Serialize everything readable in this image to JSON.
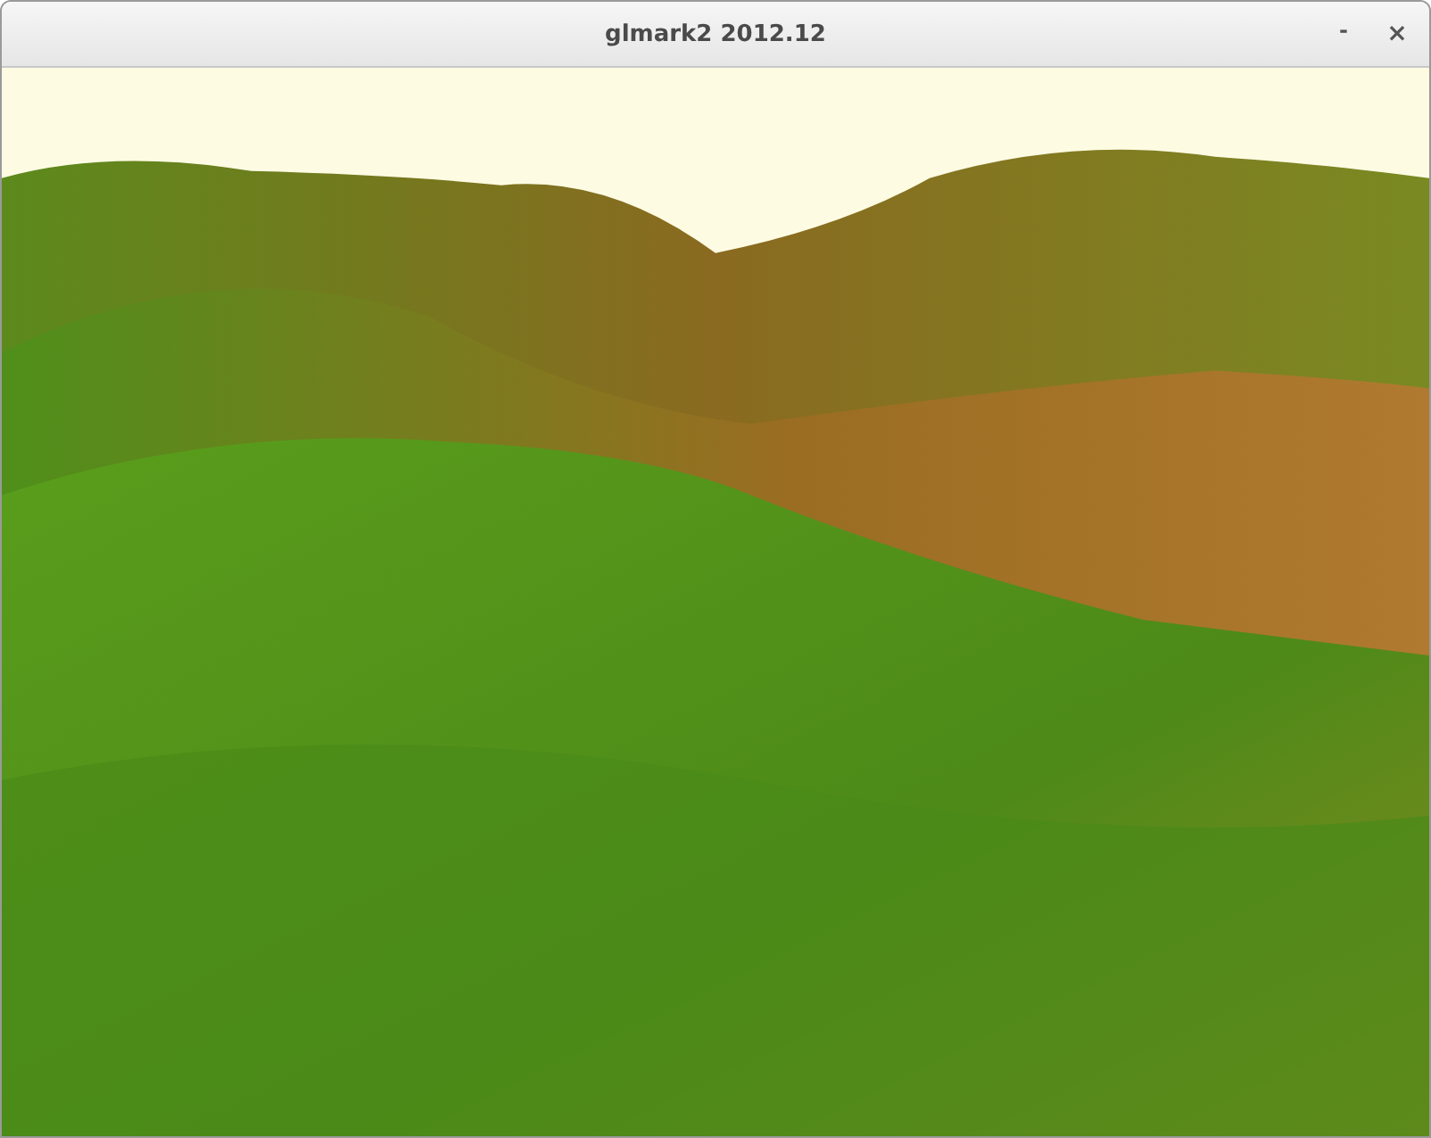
{
  "window": {
    "title": "glmark2 2012.12",
    "buttons": [
      {
        "kind": "minimize",
        "label": "-"
      },
      {
        "kind": "close",
        "label": "×"
      }
    ]
  }
}
